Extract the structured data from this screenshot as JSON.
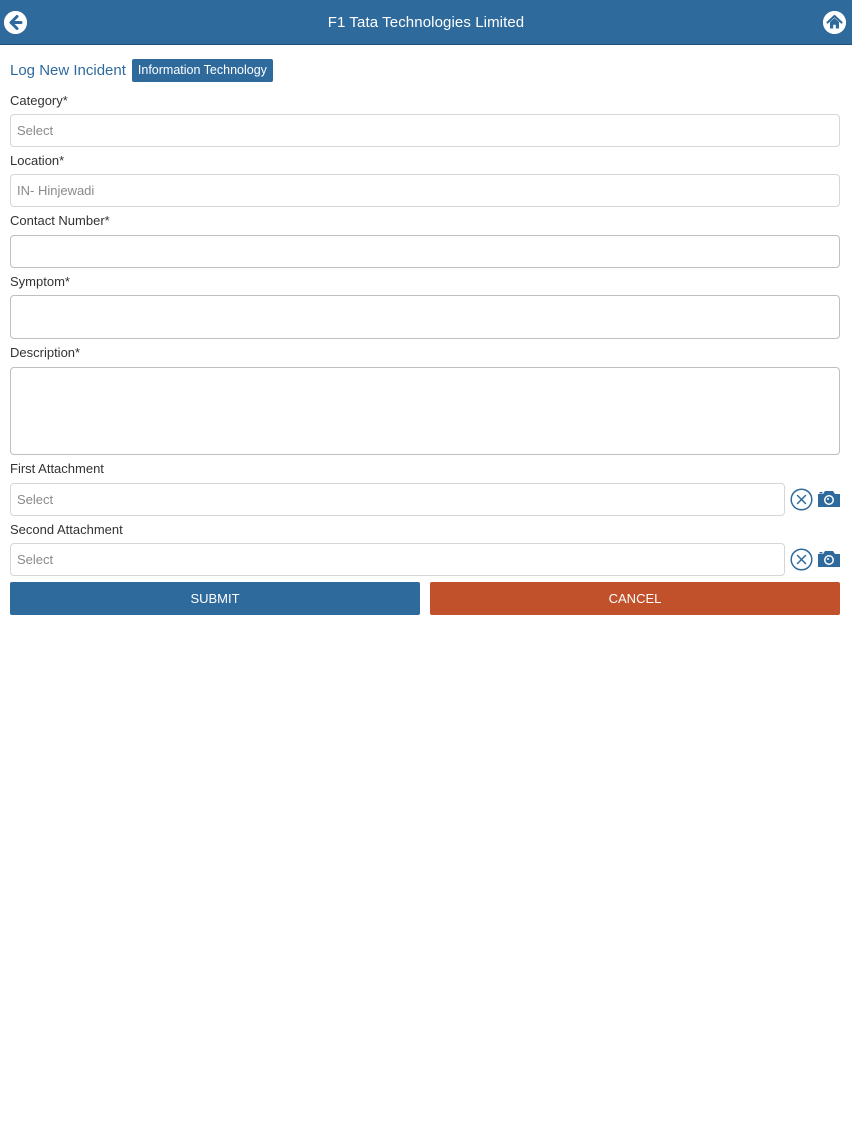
{
  "header": {
    "title": "F1 Tata Technologies Limited"
  },
  "page": {
    "title": "Log New Incident",
    "department_badge": "Information Technology"
  },
  "form": {
    "category": {
      "label": "Category*",
      "value": "Select"
    },
    "location": {
      "label": "Location*",
      "value": "IN- Hinjewadi"
    },
    "contact_number": {
      "label": "Contact Number*",
      "value": ""
    },
    "symptom": {
      "label": "Symptom*",
      "value": ""
    },
    "description": {
      "label": "Description*",
      "value": ""
    },
    "first_attachment": {
      "label": "First Attachment",
      "value": "Select"
    },
    "second_attachment": {
      "label": "Second Attachment",
      "value": "Select"
    }
  },
  "actions": {
    "submit_label": "SUBMIT",
    "cancel_label": "CANCEL"
  },
  "colors": {
    "primary": "#2f6a9d",
    "cancel": "#c0512a"
  }
}
